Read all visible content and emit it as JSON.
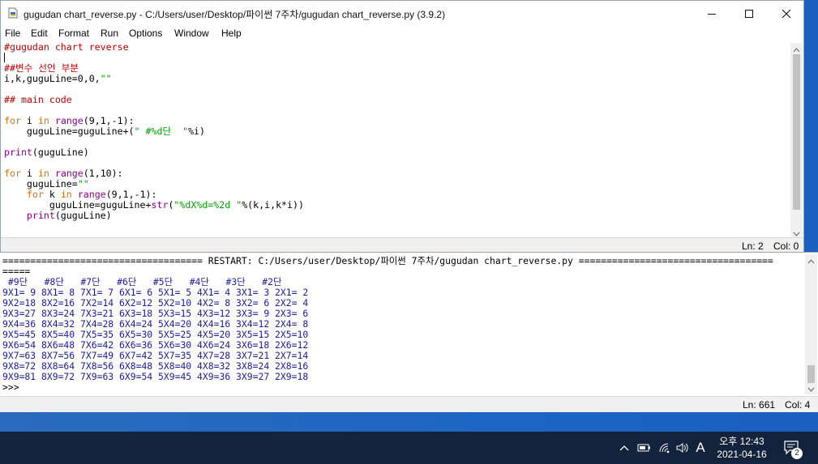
{
  "editor": {
    "title": "gugudan chart_reverse.py - C:/Users/user/Desktop/파이썬 7주차/gugudan chart_reverse.py (3.9.2)",
    "menu": [
      "File",
      "Edit",
      "Format",
      "Run",
      "Options",
      "Window",
      "Help"
    ],
    "code_lines": [
      "#gugudan chart reverse",
      "",
      "##변수 선언 부분",
      "i,k,guguLine=0,0,\"\"",
      "",
      "## main code",
      "",
      "for i in range(9,1,-1):",
      "    guguLine=guguLine+(\" #%d단  \"%i)",
      "",
      "print(guguLine)",
      "",
      "for i in range(1,10):",
      "    guguLine=\"\"",
      "    for k in range(9,1,-1):",
      "        guguLine=guguLine+str(\"%dX%d=%2d \"%(k,i,k*i))",
      "    print(guguLine)"
    ],
    "status": {
      "ln": "Ln: 2",
      "col": "Col: 0"
    }
  },
  "shell": {
    "restart_line": "==================================== RESTART: C:/Users/user/Desktop/파이썬 7주차/gugudan chart_reverse.py ===================================",
    "restart_tail": "=====",
    "header": " #9단   #8단   #7단   #6단   #5단   #4단   #3단   #2단",
    "rows": [
      "9X1= 9 8X1= 8 7X1= 7 6X1= 6 5X1= 5 4X1= 4 3X1= 3 2X1= 2",
      "9X2=18 8X2=16 7X2=14 6X2=12 5X2=10 4X2= 8 3X2= 6 2X2= 4",
      "9X3=27 8X3=24 7X3=21 6X3=18 5X3=15 4X3=12 3X3= 9 2X3= 6",
      "9X4=36 8X4=32 7X4=28 6X4=24 5X4=20 4X4=16 3X4=12 2X4= 8",
      "9X5=45 8X5=40 7X5=35 6X5=30 5X5=25 4X5=20 3X5=15 2X5=10",
      "9X6=54 8X6=48 7X6=42 6X6=36 5X6=30 4X6=24 3X6=18 2X6=12",
      "9X7=63 8X7=56 7X7=49 6X7=42 5X7=35 4X7=28 3X7=21 2X7=14",
      "9X8=72 8X8=64 7X8=56 6X8=48 5X8=40 4X8=32 3X8=24 2X8=16",
      "9X9=81 8X9=72 7X9=63 6X9=54 5X9=45 4X9=36 3X9=27 2X9=18"
    ],
    "prompt": ">>>",
    "status": {
      "ln": "Ln: 661",
      "col": "Col: 4"
    }
  },
  "taskbar": {
    "ime": "A",
    "time": "오후 12:43",
    "date": "2021-04-16",
    "notification_count": "2"
  },
  "colors": {
    "keyword": "#e07000",
    "builtin": "#900090",
    "comment": "#c00000",
    "string": "#00a000",
    "shell_output": "#1b1b9a",
    "taskbar": "#12233b"
  }
}
